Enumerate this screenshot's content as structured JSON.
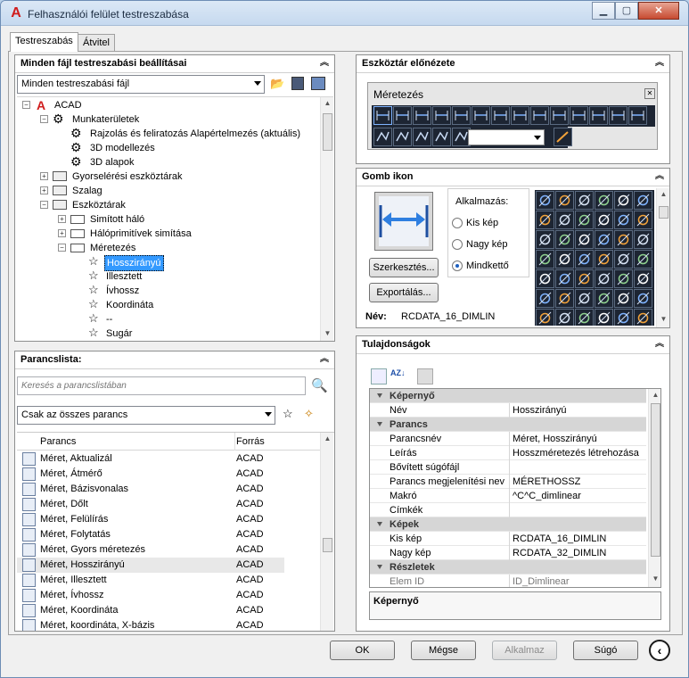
{
  "window": {
    "title": "Felhasználói felület testreszabása"
  },
  "tabs": [
    {
      "label": "Testreszabás"
    },
    {
      "label": "Átvitel"
    }
  ],
  "customizations_panel": {
    "title": "Minden fájl testreszabási beállításai",
    "combo_value": "Minden testreszabási fájl",
    "tree": [
      {
        "label": "ACAD"
      },
      {
        "label": "Munkaterületek"
      },
      {
        "label": "Rajzolás és feliratozás Alapértelmezés (aktuális)"
      },
      {
        "label": "3D modellezés"
      },
      {
        "label": "3D alapok"
      },
      {
        "label": "Gyorselérési eszköztárak"
      },
      {
        "label": "Szalag"
      },
      {
        "label": "Eszköztárak"
      },
      {
        "label": "Simított háló"
      },
      {
        "label": "Hálóprimitívek simítása"
      },
      {
        "label": "Méretezés"
      },
      {
        "label": "Hosszirányú"
      },
      {
        "label": "Illesztett"
      },
      {
        "label": "Ívhossz"
      },
      {
        "label": "Koordináta"
      },
      {
        "label": "--"
      },
      {
        "label": "Sugár"
      }
    ]
  },
  "command_list": {
    "title": "Parancslista:",
    "search_placeholder": "Keresés a parancslistában",
    "filter_value": "Csak az összes parancs",
    "col_command": "Parancs",
    "col_source": "Forrás",
    "rows": [
      {
        "name": "Méret, Aktualizál",
        "source": "ACAD"
      },
      {
        "name": "Méret, Átmérő",
        "source": "ACAD"
      },
      {
        "name": "Méret, Bázisvonalas",
        "source": "ACAD"
      },
      {
        "name": "Méret, Dőlt",
        "source": "ACAD"
      },
      {
        "name": "Méret, Felülírás",
        "source": "ACAD"
      },
      {
        "name": "Méret, Folytatás",
        "source": "ACAD"
      },
      {
        "name": "Méret, Gyors méretezés",
        "source": "ACAD"
      },
      {
        "name": "Méret, Hosszirányú",
        "source": "ACAD"
      },
      {
        "name": "Méret, Illesztett",
        "source": "ACAD"
      },
      {
        "name": "Méret, Ívhossz",
        "source": "ACAD"
      },
      {
        "name": "Méret, Koordináta",
        "source": "ACAD"
      },
      {
        "name": "Méret, koordináta, X-bázis",
        "source": "ACAD"
      }
    ]
  },
  "toolbar_preview": {
    "title": "Eszköztár előnézete",
    "toolbar_name": "Méretezés"
  },
  "button_image": {
    "title": "Gomb ikon",
    "apply_label": "Alkalmazás:",
    "radio_small": "Kis kép",
    "radio_large": "Nagy kép",
    "radio_both": "Mindkettő",
    "edit_button": "Szerkesztés...",
    "export_button": "Exportálás...",
    "name_label": "Név:",
    "name_value": "RCDATA_16_DIMLIN"
  },
  "properties": {
    "title": "Tulajdonságok",
    "rows": [
      {
        "type": "cat",
        "key": "Képernyő",
        "value": ""
      },
      {
        "type": "row",
        "key": "Név",
        "value": "Hosszirányú"
      },
      {
        "type": "cat",
        "key": "Parancs",
        "value": ""
      },
      {
        "type": "row",
        "key": "Parancsnév",
        "value": "Méret, Hosszirányú"
      },
      {
        "type": "row",
        "key": "Leírás",
        "value": "Hosszméretezés létrehozása"
      },
      {
        "type": "row",
        "key": "Bővített súgófájl",
        "value": ""
      },
      {
        "type": "row",
        "key": "Parancs megjelenítési nev",
        "value": "MÉRETHOSSZ"
      },
      {
        "type": "row",
        "key": "Makró",
        "value": "^C^C_dimlinear"
      },
      {
        "type": "row",
        "key": "Címkék",
        "value": ""
      },
      {
        "type": "cat",
        "key": "Képek",
        "value": ""
      },
      {
        "type": "row",
        "key": "Kis kép",
        "value": "RCDATA_16_DIMLIN"
      },
      {
        "type": "row",
        "key": "Nagy kép",
        "value": "RCDATA_32_DIMLIN"
      },
      {
        "type": "cat",
        "key": "Részletek",
        "value": ""
      },
      {
        "type": "row",
        "key": "Elem ID",
        "value": "ID_Dimlinear"
      }
    ],
    "description_title": "Képernyő"
  },
  "footer": {
    "ok": "OK",
    "cancel": "Mégse",
    "apply": "Alkalmaz",
    "help": "Súgó"
  },
  "colors": {
    "accent": "#3399ff",
    "toolbar_bg": "#1d2533"
  }
}
